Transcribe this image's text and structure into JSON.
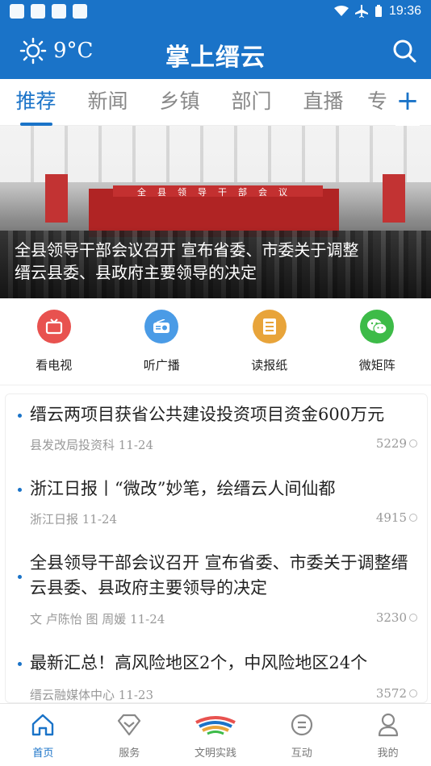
{
  "status": {
    "time": "19:36"
  },
  "header": {
    "weather_temp": "9°C",
    "title": "掌上缙云",
    "search_icon": "search-icon"
  },
  "tabs": [
    {
      "label": "推荐",
      "active": true
    },
    {
      "label": "新闻"
    },
    {
      "label": "乡镇"
    },
    {
      "label": "部门"
    },
    {
      "label": "直播"
    },
    {
      "label": "专"
    }
  ],
  "banner": {
    "stage_text": "全县领导干部会议",
    "caption": "全县领导干部会议召开 宣布省委、市委关于调整缙云县委、县政府主要领导的决定"
  },
  "shortcuts": [
    {
      "label": "看电视",
      "icon": "tv-icon",
      "color": "#e8524f"
    },
    {
      "label": "听广播",
      "icon": "radio-icon",
      "color": "#4a9be6"
    },
    {
      "label": "读报纸",
      "icon": "newspaper-icon",
      "color": "#e8a43a"
    },
    {
      "label": "微矩阵",
      "icon": "wechat-icon",
      "color": "#3dbb48"
    }
  ],
  "news": [
    {
      "title": "缙云两项目获省公共建设投资项目资金600万元",
      "source": "县发改局投资科 11-24",
      "views": "5229"
    },
    {
      "title": "浙江日报丨“微改”妙笔，绘缙云人间仙都",
      "source": "浙江日报 11-24",
      "views": "4915"
    },
    {
      "title": "全县领导干部会议召开 宣布省委、市委关于调整缙云县委、县政府主要领导的决定",
      "source": "文 卢陈怡 图 周媛 11-24",
      "views": "3230"
    },
    {
      "title": "最新汇总！高风险地区2个，中风险地区24个",
      "source": "缙云融媒体中心 11-23",
      "views": "3572"
    }
  ],
  "bottom_nav": [
    {
      "label": "首页",
      "icon": "home-icon",
      "active": true
    },
    {
      "label": "服务",
      "icon": "service-icon"
    },
    {
      "label": "文明实践",
      "icon": "civilization-logo-icon"
    },
    {
      "label": "互动",
      "icon": "chat-icon"
    },
    {
      "label": "我的",
      "icon": "user-icon"
    }
  ],
  "colors": {
    "primary": "#1a73c8",
    "text": "#222222",
    "meta": "#999999"
  }
}
